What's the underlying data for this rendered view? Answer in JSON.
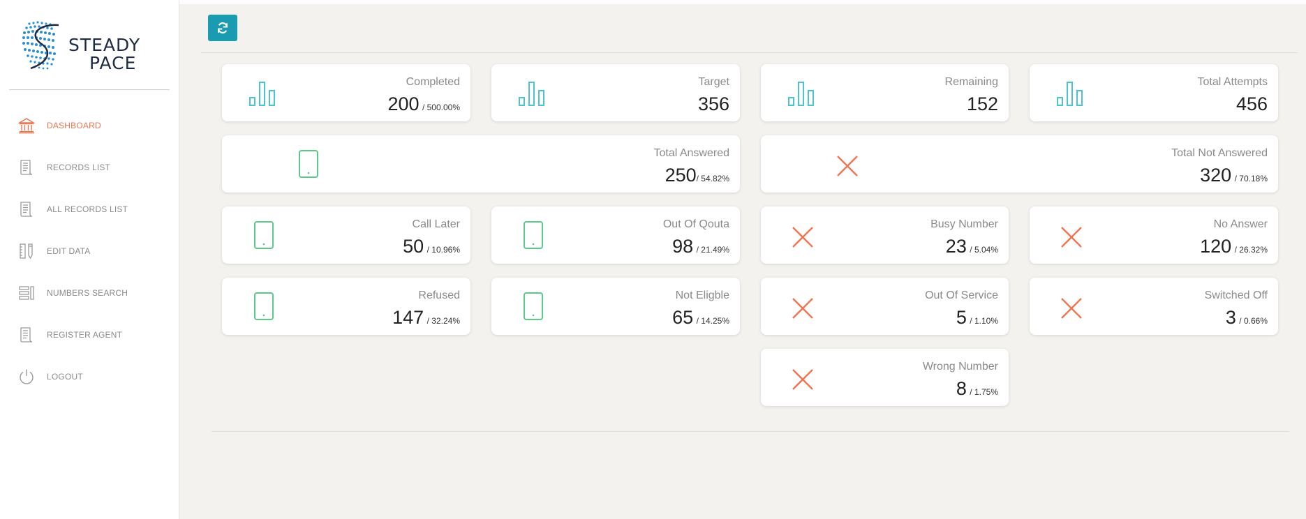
{
  "brand": {
    "line1": "STEADY",
    "line2": "PACE"
  },
  "sidebar": {
    "items": [
      {
        "label": "DASHBOARD",
        "icon": "bank-icon",
        "active": true
      },
      {
        "label": "RECORDS LIST",
        "icon": "document-icon"
      },
      {
        "label": "ALL RECORDS LIST",
        "icon": "document-icon"
      },
      {
        "label": "EDIT DATA",
        "icon": "ruler-pencil-icon"
      },
      {
        "label": "NUMBERS SEARCH",
        "icon": "list-icon"
      },
      {
        "label": "REGISTER AGENT",
        "icon": "document-icon"
      },
      {
        "label": "LOGOUT",
        "icon": "power-icon"
      }
    ]
  },
  "toolbar": {
    "refresh_icon": "refresh-icon"
  },
  "colors": {
    "accent": "#1b9bb1",
    "active_nav": "#e8744f",
    "bar_icon": "#4cc3d0",
    "phone_icon": "#5cc98a",
    "x_icon": "#ef7552"
  },
  "cards": {
    "completed": {
      "title": "Completed",
      "value": "200",
      "pct": "/ 500.00%"
    },
    "target": {
      "title": "Target",
      "value": "356"
    },
    "remaining": {
      "title": "Remaining",
      "value": "152"
    },
    "total_attempts": {
      "title": "Total Attempts",
      "value": "456"
    },
    "total_answered": {
      "title": "Total Answered",
      "value": "250",
      "pct": "/ 54.82%"
    },
    "total_not_answered": {
      "title": "Total Not Answered",
      "value": "320",
      "pct": "/ 70.18%"
    },
    "call_later": {
      "title": "Call Later",
      "value": "50",
      "pct": "/ 10.96%"
    },
    "out_of_qouta": {
      "title": "Out Of Qouta",
      "value": "98",
      "pct": "/ 21.49%"
    },
    "busy_number": {
      "title": "Busy Number",
      "value": "23",
      "pct": "/ 5.04%"
    },
    "no_answer": {
      "title": "No Answer",
      "value": "120",
      "pct": "/ 26.32%"
    },
    "refused": {
      "title": "Refused",
      "value": "147",
      "pct": "/ 32.24%"
    },
    "not_eligble": {
      "title": "Not Eligble",
      "value": "65",
      "pct": "/ 14.25%"
    },
    "out_of_service": {
      "title": "Out Of Service",
      "value": "5",
      "pct": "/ 1.10%"
    },
    "switched_off": {
      "title": "Switched Off",
      "value": "3",
      "pct": "/ 0.66%"
    },
    "wrong_number": {
      "title": "Wrong Number",
      "value": "8",
      "pct": "/ 1.75%"
    }
  }
}
